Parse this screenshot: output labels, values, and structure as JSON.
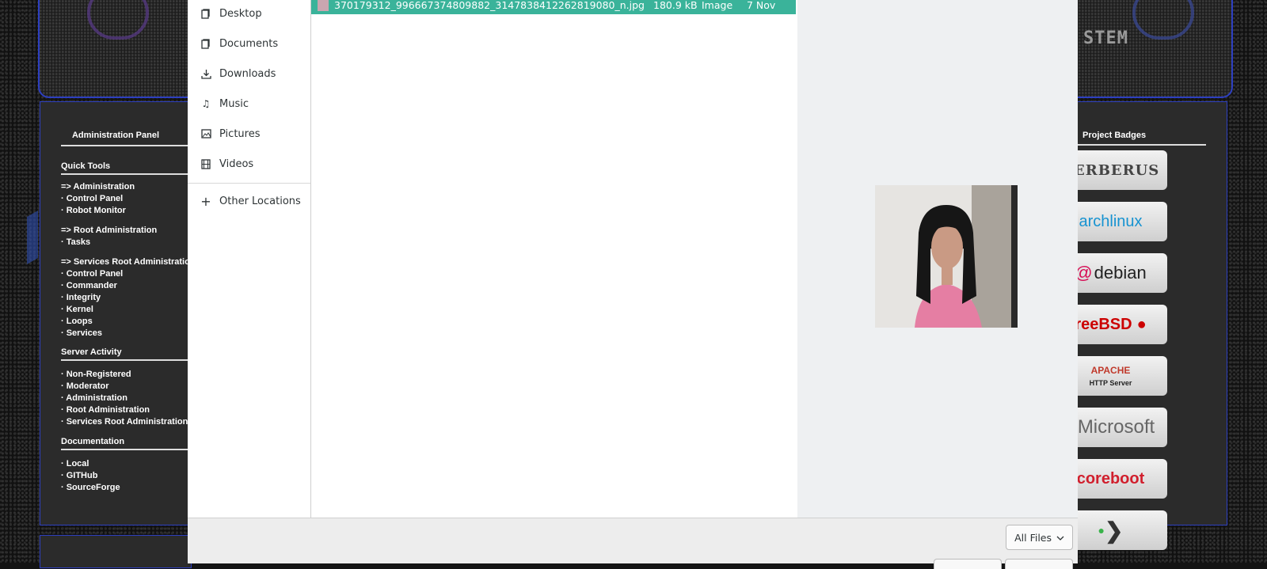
{
  "background_page": {
    "banner_text": "STEM",
    "admin_panel": {
      "title": "Administration Panel",
      "quick_tools": "Quick Tools",
      "groups": [
        {
          "items": [
            "=> Administration",
            "· Control Panel",
            "· Robot Monitor"
          ]
        },
        {
          "items": [
            "=> Root Administration",
            "· Tasks"
          ]
        },
        {
          "items": [
            "=> Services Root Administration",
            "· Control Panel",
            "· Commander",
            "· Integrity",
            "· Kernel",
            "· Loops",
            "· Services"
          ]
        }
      ],
      "server_activity": "Server Activity",
      "activity_items": [
        "· Non-Registered",
        "· Moderator",
        "· Administration",
        "· Root Administration",
        "· Services Root Administration"
      ],
      "documentation": "Documentation",
      "doc_items": [
        "· Local",
        "· GITHub",
        "· SourceForge"
      ]
    },
    "badges_panel": {
      "title": "Project Badges",
      "badges": [
        "CERBERUS",
        "archlinux",
        "debian",
        "reeBSD",
        "APACHE",
        "HTTP Server",
        "Microsoft",
        "coreboot"
      ]
    }
  },
  "file_dialog": {
    "places": [
      {
        "label": "Desktop",
        "icon": "desktop-folder-icon"
      },
      {
        "label": "Documents",
        "icon": "documents-folder-icon"
      },
      {
        "label": "Downloads",
        "icon": "download-icon"
      },
      {
        "label": "Music",
        "icon": "music-note-icon"
      },
      {
        "label": "Pictures",
        "icon": "picture-icon"
      },
      {
        "label": "Videos",
        "icon": "film-icon"
      }
    ],
    "other_locations": "Other Locations",
    "files": [
      {
        "name": "370179312_996667374809882_3147838412262819080_n.jpg",
        "size": "180.9 kB",
        "type": "Image",
        "modified": "7 Nov"
      }
    ],
    "filter": "All Files",
    "colors": {
      "selection": "#3ab39a",
      "preview_bg": "#eef0f2"
    }
  }
}
